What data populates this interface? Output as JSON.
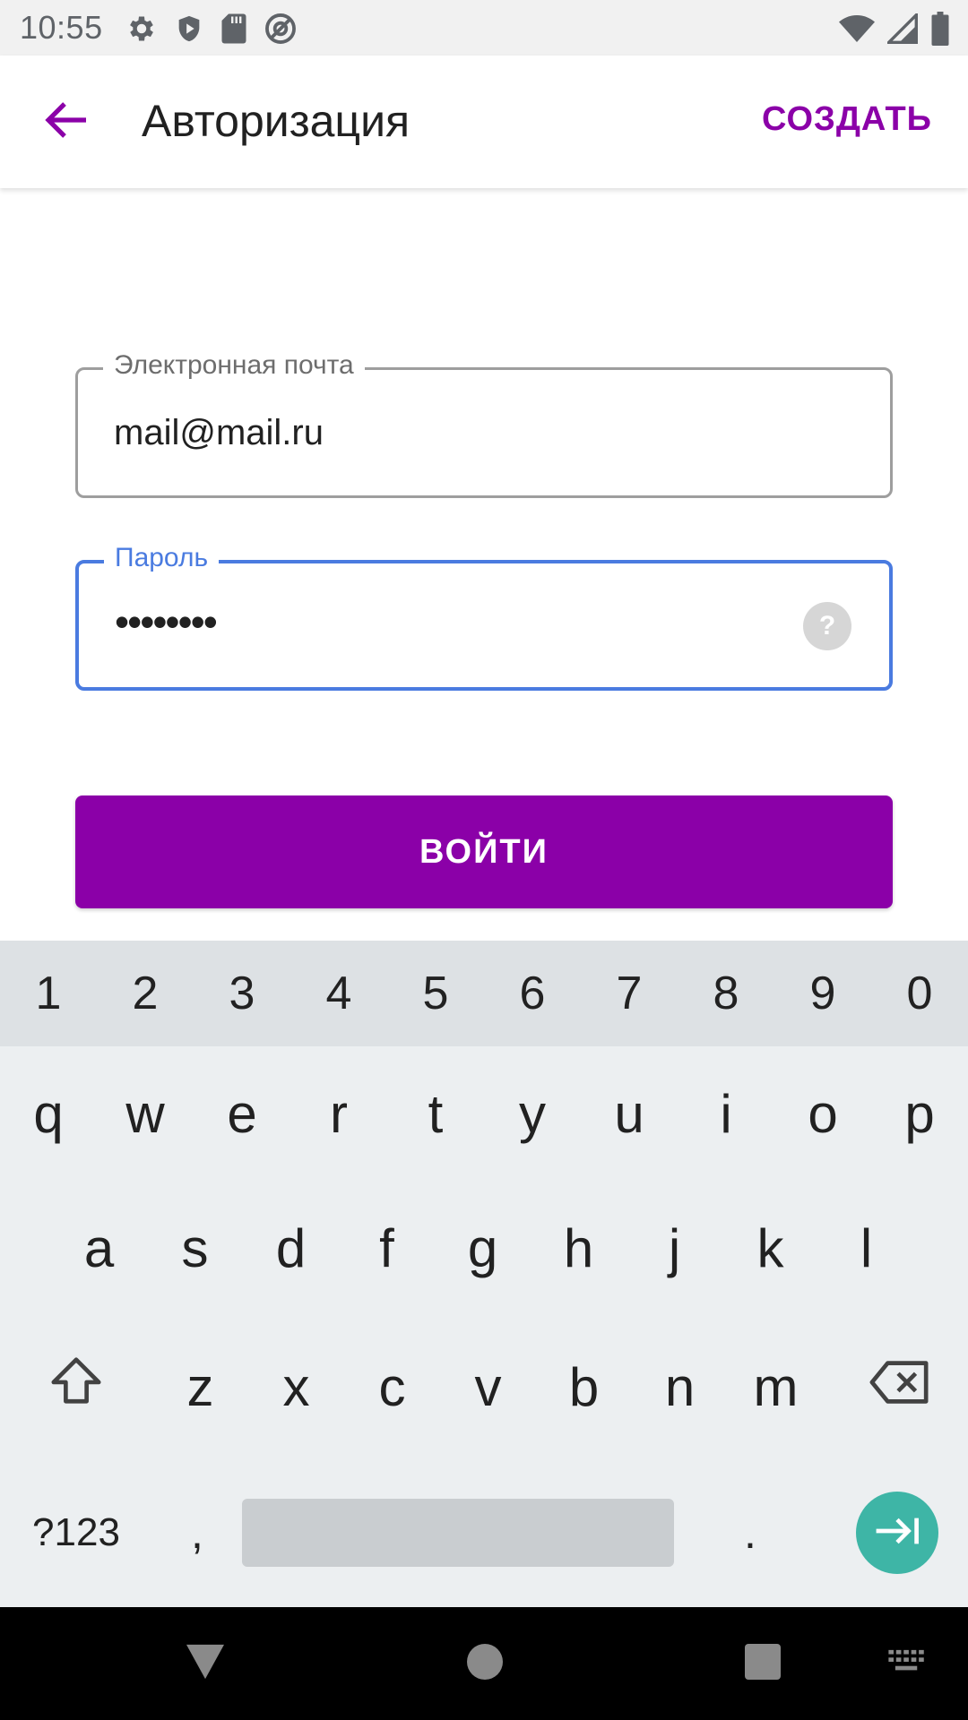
{
  "status_bar": {
    "time": "10:55",
    "left_icons": [
      "gear-icon",
      "shield-play-icon",
      "sd-card-icon",
      "at-sign-icon"
    ],
    "right_icons": [
      "wifi-icon",
      "signal-icon",
      "battery-icon"
    ]
  },
  "app_bar": {
    "title": "Авторизация",
    "create_label": "СОЗДАТЬ",
    "accent_color": "#8b00a8"
  },
  "form": {
    "email": {
      "label": "Электронная почта",
      "value": "mail@mail.ru"
    },
    "password": {
      "label": "Пароль",
      "value": "••••••••",
      "help": "?",
      "focus_color": "#4a7be0"
    },
    "login_label": "ВОЙТИ"
  },
  "keyboard": {
    "numbers": [
      "1",
      "2",
      "3",
      "4",
      "5",
      "6",
      "7",
      "8",
      "9",
      "0"
    ],
    "row1": [
      "q",
      "w",
      "e",
      "r",
      "t",
      "y",
      "u",
      "i",
      "o",
      "p"
    ],
    "row2": [
      "a",
      "s",
      "d",
      "f",
      "g",
      "h",
      "j",
      "k",
      "l"
    ],
    "row3": [
      "z",
      "x",
      "c",
      "v",
      "b",
      "n",
      "m"
    ],
    "symbols_label": "?123",
    "comma": ",",
    "period": ".",
    "enter_color": "#3eb5a6"
  }
}
